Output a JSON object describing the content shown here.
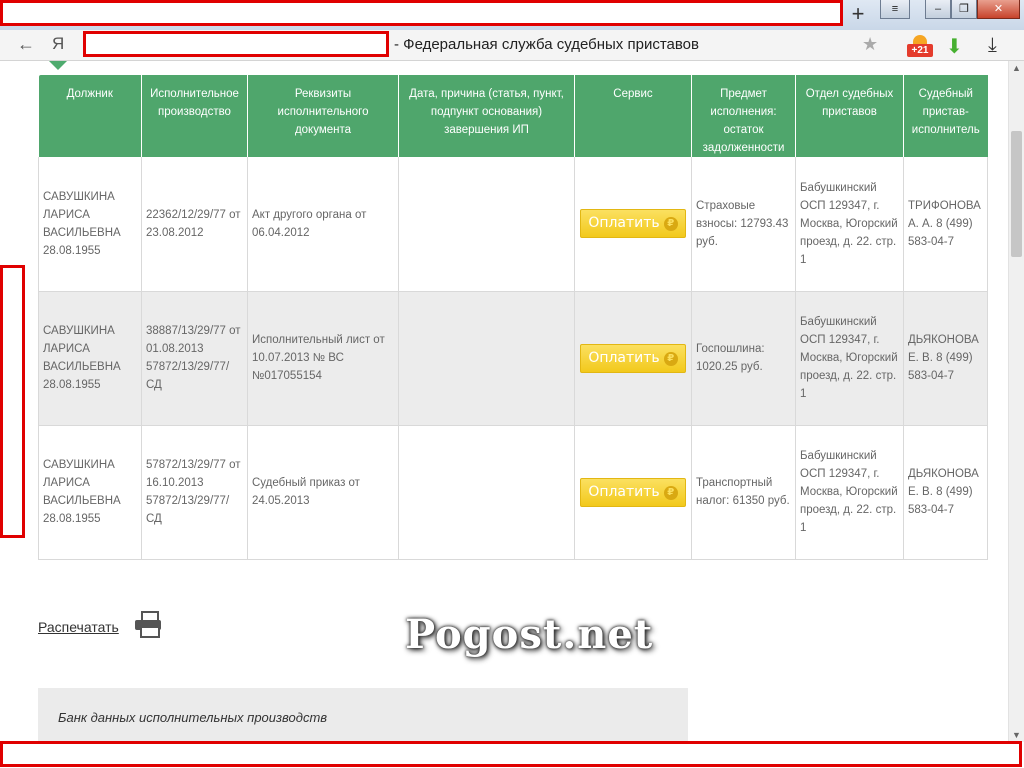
{
  "browser": {
    "new_tab_label": "+",
    "yandex_logo": "Я",
    "page_title_suffix": "- Федеральная служба судебных приставов",
    "weather_badge": "+21",
    "icons": {
      "back": "back-arrow-icon",
      "star": "bookmark-star-icon",
      "weather": "weather-icon",
      "download_green": "download-icon",
      "download": "downloads-icon"
    }
  },
  "table": {
    "headers": [
      "Должник",
      "Исполнительное производство",
      "Реквизиты исполнительного документа",
      "Дата, причина (статья, пункт, подпункт основания) завершения ИП",
      "Сервис",
      "Предмет исполнения: остаток задолженности",
      "Отдел судебных приставов",
      "Судебный пристав-исполнитель"
    ],
    "pay_label": "Оплатить",
    "rows": [
      {
        "debtor": "САВУШКИНА ЛАРИСА ВАСИЛЬЕВНА 28.08.1955",
        "proceeding": "22362/12/29/77 от 23.08.2012",
        "document": "Акт другого органа от 06.04.2012",
        "completion": "",
        "subject": "Страховые взносы: 12793.43 руб.",
        "department": "Бабушкинский ОСП 129347, г. Москва, Югорский проезд, д. 22. стр. 1",
        "bailiff": "ТРИФОНОВА А. А. 8 (499) 583-04-7"
      },
      {
        "debtor": "САВУШКИНА ЛАРИСА ВАСИЛЬЕВНА 28.08.1955",
        "proceeding": "38887/13/29/77 от 01.08.2013 57872/13/29/77/СД",
        "document": "Исполнительный лист от 10.07.2013 № ВС №017055154",
        "completion": "",
        "subject": "Госпошлина: 1020.25 руб.",
        "department": "Бабушкинский ОСП 129347, г. Москва, Югорский проезд, д. 22. стр. 1",
        "bailiff": "ДЬЯКОНОВА Е. В. 8 (499) 583-04-7"
      },
      {
        "debtor": "САВУШКИНА ЛАРИСА ВАСИЛЬЕВНА 28.08.1955",
        "proceeding": "57872/13/29/77 от 16.10.2013 57872/13/29/77/СД",
        "document": "Судебный приказ от 24.05.2013",
        "completion": "",
        "subject": "Транспортный налог: 61350 руб.",
        "department": "Бабушкинский ОСП 129347, г. Москва, Югорский проезд, д. 22. стр. 1",
        "bailiff": "ДЬЯКОНОВА Е. В. 8 (499) 583-04-7"
      }
    ]
  },
  "print_label": "Распечатать",
  "watermark": "Pogost.net",
  "bank_title": "Банк данных исполнительных производств"
}
